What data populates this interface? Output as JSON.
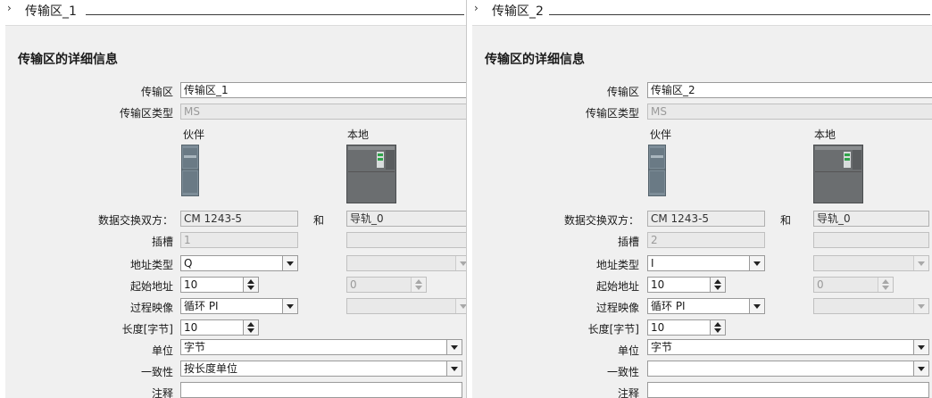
{
  "panes": [
    {
      "header_title": "传输区_1",
      "panel_title": "传输区的详细信息",
      "labels": {
        "area": "传输区",
        "area_type": "传输区类型",
        "partner": "伙伴",
        "local": "本地",
        "exchange": "数据交换双方：",
        "and": "和",
        "slot": "插槽",
        "addr_type": "地址类型",
        "start_addr": "起始地址",
        "process_image": "过程映像",
        "length": "长度[字节]",
        "unit": "单位",
        "consistency": "一致性",
        "comment": "注释"
      },
      "values": {
        "area": "传输区_1",
        "area_type": "MS",
        "partner_device": "CM 1243-5",
        "local_device": "导轨_0",
        "partner_slot": "1",
        "addr_type": "Q",
        "start_addr": "10",
        "local_start_addr": "0",
        "process_image": "循环 PI",
        "length": "10",
        "unit": "字节",
        "consistency": "按长度单位",
        "comment": ""
      }
    },
    {
      "header_title": "传输区_2",
      "panel_title": "传输区的详细信息",
      "labels": {
        "area": "传输区",
        "area_type": "传输区类型",
        "partner": "伙伴",
        "local": "本地",
        "exchange": "数据交换双方：",
        "and": "和",
        "slot": "插槽",
        "addr_type": "地址类型",
        "start_addr": "起始地址",
        "process_image": "过程映像",
        "length": "长度[字节]",
        "unit": "单位",
        "consistency": "一致性",
        "comment": "注释"
      },
      "values": {
        "area": "传输区_2",
        "area_type": "MS",
        "partner_device": "CM 1243-5",
        "local_device": "导轨_0",
        "partner_slot": "2",
        "addr_type": "I",
        "start_addr": "10",
        "local_start_addr": "0",
        "process_image": "循环 PI",
        "length": "10",
        "unit": "字节",
        "consistency": "",
        "comment": ""
      }
    }
  ],
  "icons": [
    "chevron-right-icon",
    "dropdown-arrow-icon",
    "spinner-icon",
    "partner-module-icon",
    "local-plc-icon"
  ]
}
